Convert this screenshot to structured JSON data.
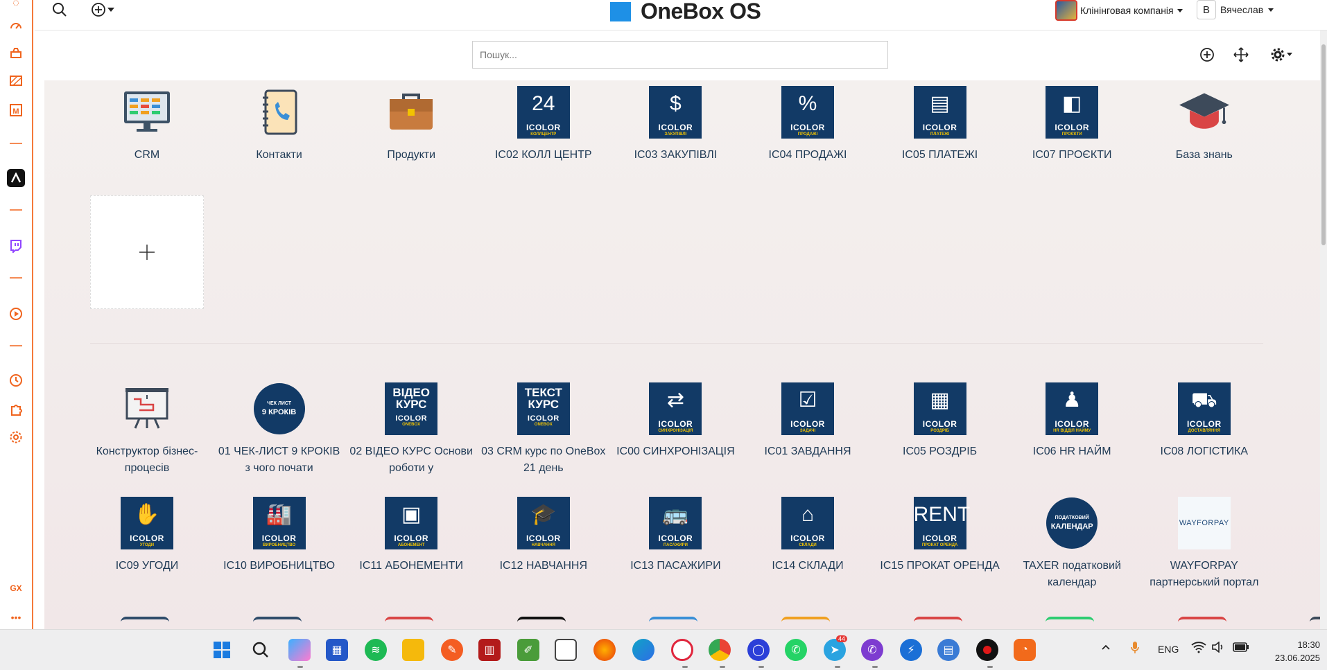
{
  "app": {
    "title": "OneBox OS"
  },
  "header": {
    "company": "Клінінговая компанія",
    "user_initial": "В",
    "user_name": "Вячеслав"
  },
  "search": {
    "placeholder": "Пошук..."
  },
  "top_apps": [
    {
      "label": "CRM",
      "icon": "monitor-icon"
    },
    {
      "label": "Контакти",
      "icon": "phonebook-icon"
    },
    {
      "label": "Продукти",
      "icon": "briefcase-icon"
    },
    {
      "label": "IC02 КОЛЛ ЦЕНТР",
      "icon": "icolor-icon",
      "brand": "ICOLOR",
      "sub": "КОЛЛЦЕНТР",
      "glyph": "24"
    },
    {
      "label": "IC03 ЗАКУПІВЛІ",
      "icon": "icolor-icon",
      "brand": "ICOLOR",
      "sub": "ЗАКУПІВЛІ",
      "glyph": "$"
    },
    {
      "label": "IC04 ПРОДАЖІ",
      "icon": "icolor-icon",
      "brand": "ICOLOR",
      "sub": "ПРОДАЖІ",
      "glyph": "%"
    },
    {
      "label": "IC05 ПЛАТЕЖІ",
      "icon": "icolor-icon",
      "brand": "ICOLOR",
      "sub": "ПЛАТЕЖІ",
      "glyph": "▤"
    },
    {
      "label": "IC07 ПРОЄКТИ",
      "icon": "icolor-icon",
      "brand": "ICOLOR",
      "sub": "ПРОЄКТИ",
      "glyph": "◧"
    },
    {
      "label": "База знань",
      "icon": "graduation-cap-icon"
    }
  ],
  "apps_row1": [
    {
      "label": "Конструктор бізнес-процесів",
      "icon": "process-board-icon"
    },
    {
      "label": "01 ЧЕК-ЛИСТ 9 КРОКІВ з чого почати",
      "icon": "circle-badge-icon",
      "badge_top": "ЧЕК ЛИСТ",
      "badge_main": "9 КРОКІВ"
    },
    {
      "label": "02 ВІДЕО КУРС Основи роботи у",
      "icon": "course-icon",
      "title_top": "ВІДЕО",
      "title_bottom": "КУРС",
      "brand": "ICOLOR",
      "sub": "ONEBOX"
    },
    {
      "label": "03 CRM курс по OneBox 21 день",
      "icon": "course-icon",
      "title_top": "ТЕКСТ",
      "title_bottom": "КУРС",
      "brand": "ICOLOR",
      "sub": "ONEBOX"
    },
    {
      "label": "IC00 СИНХРОНІЗАЦІЯ",
      "icon": "icolor-icon",
      "brand": "ICOLOR",
      "sub": "СИНХРОНІЗАЦІЯ",
      "glyph": "⇄"
    },
    {
      "label": "IC01 ЗАВДАННЯ",
      "icon": "icolor-icon",
      "brand": "ICOLOR",
      "sub": "ЗАДАЧІ",
      "glyph": "☑"
    },
    {
      "label": "IC05 РОЗДРІБ",
      "icon": "icolor-icon",
      "brand": "ICOLOR",
      "sub": "РОЗДРІБ",
      "glyph": "▦"
    },
    {
      "label": "IC06 HR НАЙМ",
      "icon": "icolor-icon",
      "brand": "ICOLOR",
      "sub": "HR ВІДДІЛ НАЙМУ",
      "glyph": "♟"
    },
    {
      "label": "IC08 ЛОГІСТИКА",
      "icon": "icolor-icon",
      "brand": "ICOLOR",
      "sub": "ДОСТАВЛЯННЯ",
      "glyph": "⛟"
    }
  ],
  "apps_row2": [
    {
      "label": "IC09 УГОДИ",
      "icon": "icolor-icon",
      "brand": "ICOLOR",
      "sub": "УГОДИ",
      "glyph": "✋"
    },
    {
      "label": "IC10 ВИРОБНИЦТВО",
      "icon": "icolor-icon",
      "brand": "ICOLOR",
      "sub": "ВИРОБНИЦТВО",
      "glyph": "🏭"
    },
    {
      "label": "IC11 АБОНЕМЕНТИ",
      "icon": "icolor-icon",
      "brand": "ICOLOR",
      "sub": "АБОНЕМЕНТ",
      "glyph": "▣"
    },
    {
      "label": "IC12 НАВЧАННЯ",
      "icon": "icolor-icon",
      "brand": "ICOLOR",
      "sub": "НАВЧАННЯ",
      "glyph": "🎓"
    },
    {
      "label": "IC13 ПАСАЖИРИ",
      "icon": "icolor-icon",
      "brand": "ICOLOR",
      "sub": "ПАСАЖИРИ",
      "glyph": "🚌"
    },
    {
      "label": "IC14 СКЛАДИ",
      "icon": "icolor-icon",
      "brand": "ICOLOR",
      "sub": "СКЛАДИ",
      "glyph": "⌂"
    },
    {
      "label": "IC15 ПРОКАТ ОРЕНДА",
      "icon": "icolor-icon",
      "brand": "ICOLOR",
      "sub": "ПРОКАТ ОРЕНДА",
      "glyph": "RENT"
    },
    {
      "label": "TAXER податковий календар",
      "icon": "circle-badge-icon",
      "badge_top": "ПОДАТКОВИЙ",
      "badge_main": "КАЛЕНДАР"
    },
    {
      "label": "WAYFORPAY партнерський портал",
      "icon": "wayforpay-icon",
      "logo_text": "WAYFORPAY"
    }
  ],
  "taskbar": {
    "language": "ENG",
    "time": "18:30",
    "date": "23.06.2025",
    "telegram_badge": "44"
  },
  "colors": {
    "accent": "#f0641e",
    "icolor_bg": "#123a66",
    "icolor_yellow": "#f2c300",
    "logo_blue": "#1e90e6"
  }
}
